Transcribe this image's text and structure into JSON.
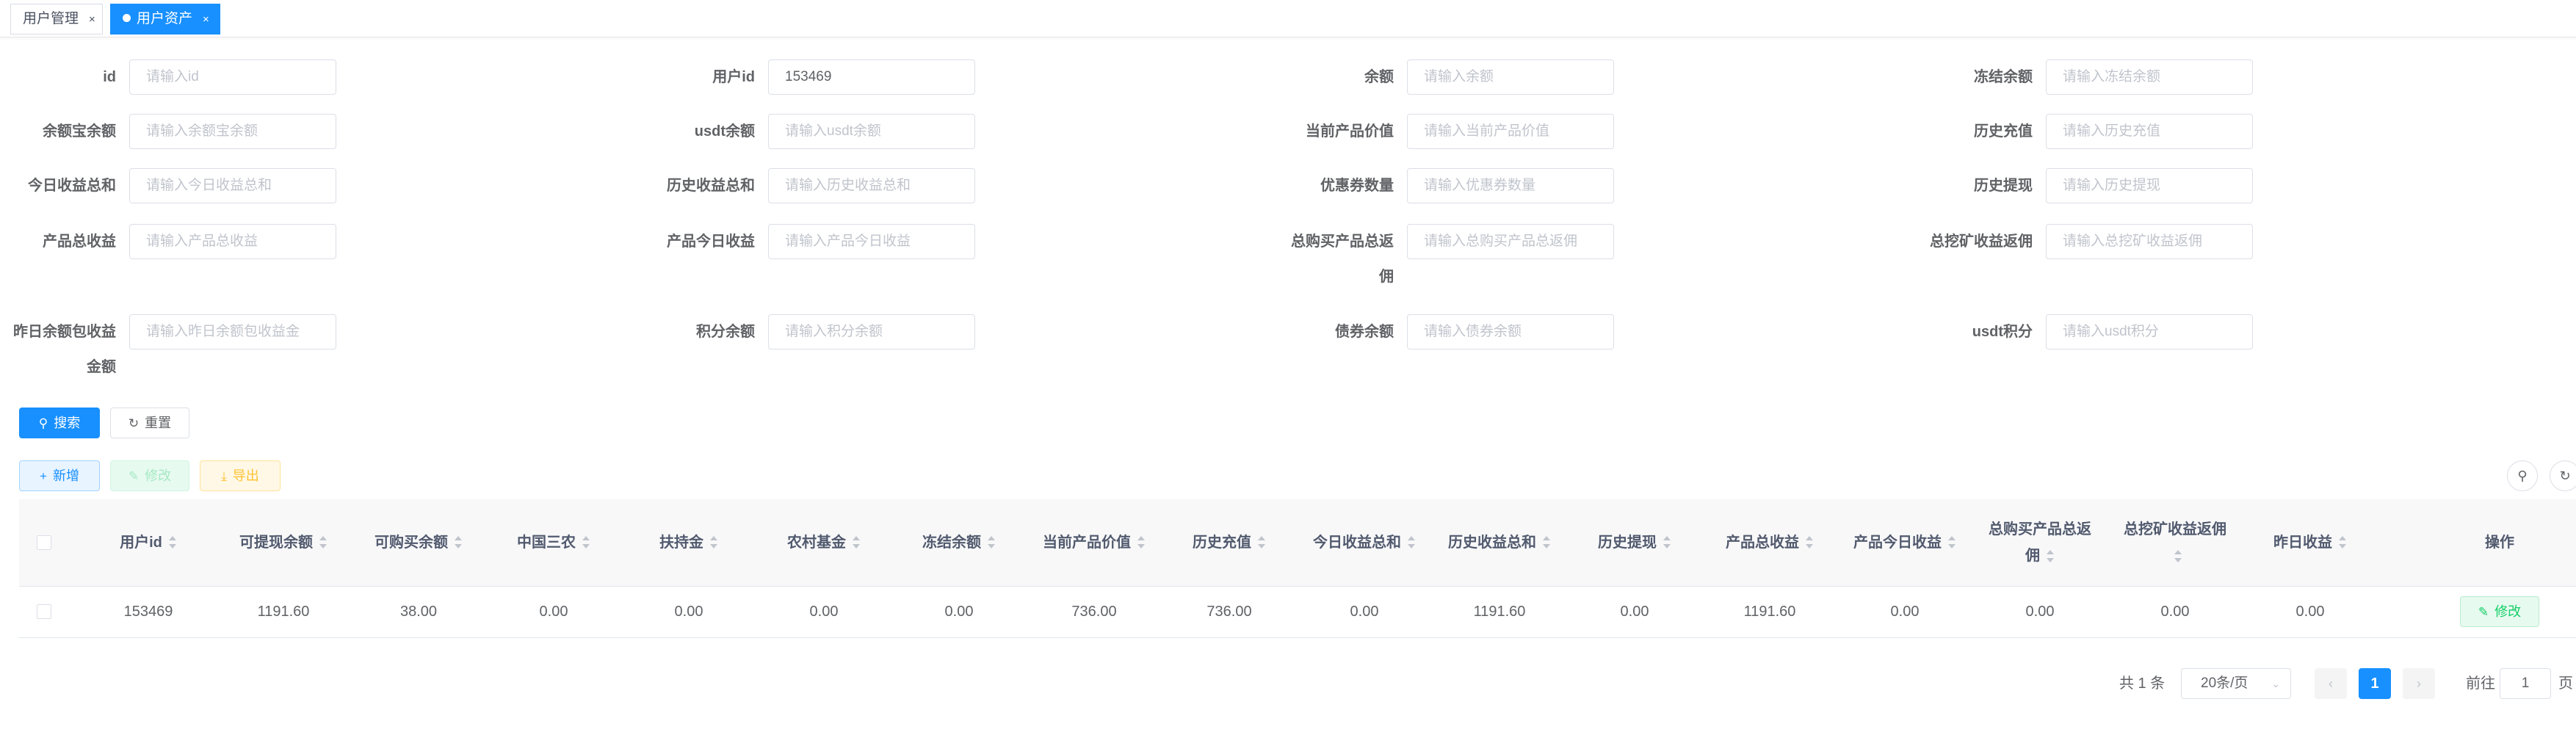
{
  "tabs": [
    {
      "label": "用户管理",
      "close": "×",
      "active": false
    },
    {
      "label": "用户资产",
      "close": "×",
      "active": true
    }
  ],
  "filters": [
    {
      "label": "id",
      "value": "",
      "placeholder": "请输入id"
    },
    {
      "label": "用户id",
      "value": "153469",
      "placeholder": "请输入用户id"
    },
    {
      "label": "余额",
      "value": "",
      "placeholder": "请输入余额"
    },
    {
      "label": "冻结余额",
      "value": "",
      "placeholder": "请输入冻结余额"
    },
    {
      "label": "余额宝余额",
      "value": "",
      "placeholder": "请输入余额宝余额"
    },
    {
      "label": "usdt余额",
      "value": "",
      "placeholder": "请输入usdt余额"
    },
    {
      "label": "当前产品价值",
      "value": "",
      "placeholder": "请输入当前产品价值"
    },
    {
      "label": "历史充值",
      "value": "",
      "placeholder": "请输入历史充值"
    },
    {
      "label": "今日收益总和",
      "value": "",
      "placeholder": "请输入今日收益总和"
    },
    {
      "label": "历史收益总和",
      "value": "",
      "placeholder": "请输入历史收益总和"
    },
    {
      "label": "优惠券数量",
      "value": "",
      "placeholder": "请输入优惠券数量"
    },
    {
      "label": "历史提现",
      "value": "",
      "placeholder": "请输入历史提现"
    },
    {
      "label": "产品总收益",
      "value": "",
      "placeholder": "请输入产品总收益"
    },
    {
      "label": "产品今日收益",
      "value": "",
      "placeholder": "请输入产品今日收益"
    },
    {
      "label": "总购买产品总返佣",
      "value": "",
      "placeholder": "请输入总购买产品总返佣"
    },
    {
      "label": "总挖矿收益返佣",
      "value": "",
      "placeholder": "请输入总挖矿收益返佣"
    },
    {
      "label": "昨日余额包收益金额",
      "value": "",
      "placeholder": "请输入昨日余额包收益金"
    },
    {
      "label": "积分余额",
      "value": "",
      "placeholder": "请输入积分余额"
    },
    {
      "label": "债券余额",
      "value": "",
      "placeholder": "请输入债券余额"
    },
    {
      "label": "usdt积分",
      "value": "",
      "placeholder": "请输入usdt积分"
    }
  ],
  "buttons": {
    "search": "搜索",
    "reset": "重置",
    "add": "新增",
    "edit": "修改",
    "export": "导出"
  },
  "table": {
    "columns": [
      "用户id",
      "可提现余额",
      "可购买余额",
      "中国三农",
      "扶持金",
      "农村基金",
      "冻结余额",
      "当前产品价值",
      "历史充值",
      "今日收益总和",
      "历史收益总和",
      "历史提现",
      "产品总收益",
      "产品今日收益",
      "总购买产品总返佣",
      "总挖矿收益返佣",
      "昨日收益"
    ],
    "action_header": "操作",
    "rows": [
      {
        "cells": [
          "153469",
          "1191.60",
          "38.00",
          "0.00",
          "0.00",
          "0.00",
          "0.00",
          "736.00",
          "736.00",
          "0.00",
          "1191.60",
          "0.00",
          "1191.60",
          "0.00",
          "0.00",
          "0.00",
          "0.00"
        ],
        "action": "修改"
      }
    ]
  },
  "pagination": {
    "total": "共 1 条",
    "page_size": "20条/页",
    "current_page": "1",
    "goto_label": "前往",
    "goto_value": "1",
    "page_suffix": "页"
  },
  "colors": {
    "primary": "#1890ff",
    "success": "#13ce66",
    "warning": "#ffba00"
  }
}
